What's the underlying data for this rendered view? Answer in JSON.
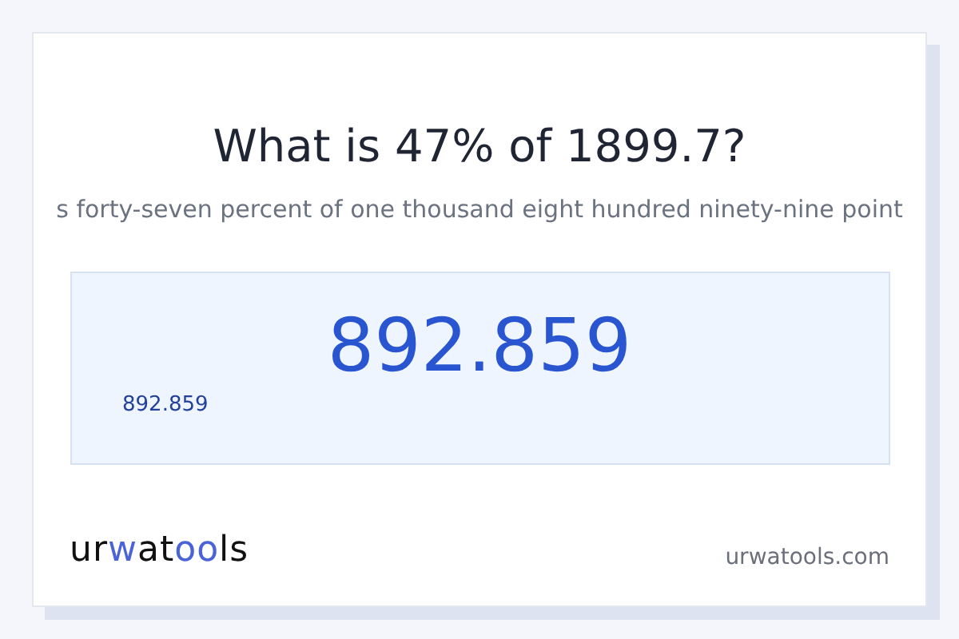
{
  "title": "What is 47% of 1899.7?",
  "subtitle": "s forty-seven percent of one thousand eight hundred ninety-nine point",
  "result": {
    "value": "892.859",
    "caption": "892.859"
  },
  "logo": [
    {
      "text": "ur",
      "accent": false
    },
    {
      "text": "w",
      "accent": true
    },
    {
      "text": "at",
      "accent": false
    },
    {
      "text": "oo",
      "accent": true
    },
    {
      "text": "ls",
      "accent": false
    }
  ],
  "site": "urwatools.com"
}
